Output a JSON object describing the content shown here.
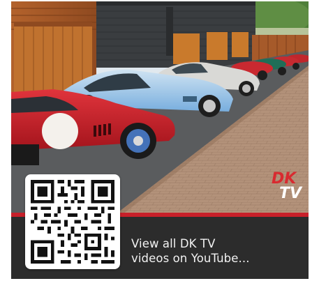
{
  "promo": {
    "logo_text": "DK TV",
    "caption_line1": "View all DK TV",
    "caption_line2": "videos on YouTube...",
    "accent_color": "#c8202a",
    "panel_color": "#2c2c2c"
  },
  "qr": {
    "target": "YouTube"
  },
  "photo": {
    "subject": "row of classic sports cars parked beside garages"
  }
}
